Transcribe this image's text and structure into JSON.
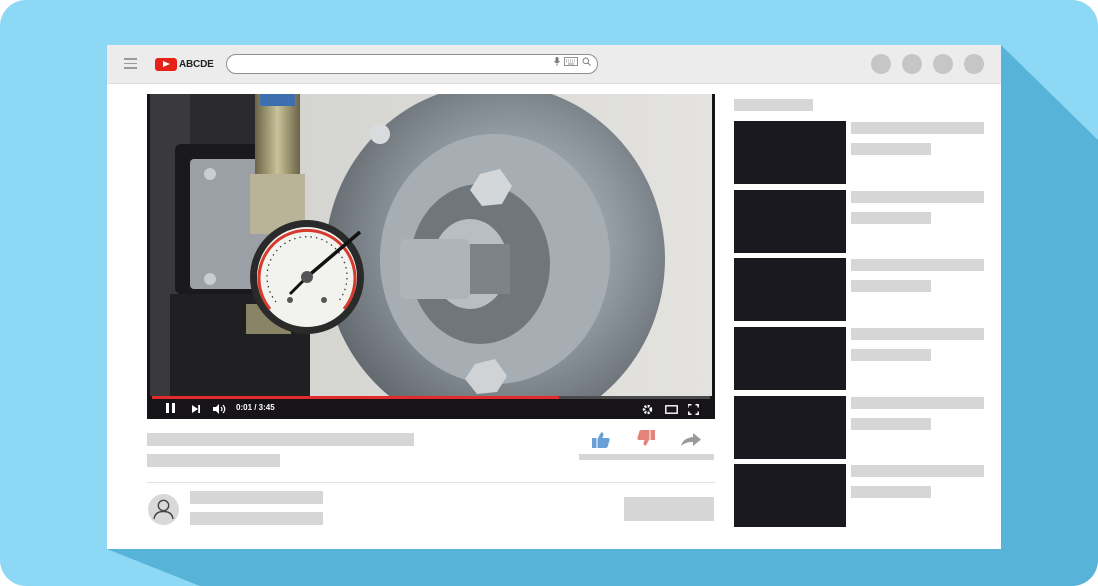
{
  "app": {
    "logo_text": "ABCDE"
  },
  "search": {
    "placeholder": ""
  },
  "player": {
    "time": "0:01 / 3:45",
    "progress_fraction": 0.73
  },
  "colors": {
    "frame": "#8dd8f5",
    "frame_shadow": "#57b3d8",
    "brand_red": "#e62117",
    "progress": "#e22c2c",
    "thumb": "#1b1920",
    "placeholder": "#d6d6d6"
  },
  "icons": {
    "menu": "hamburger-icon",
    "mic": "microphone-icon",
    "keyboard": "keyboard-icon",
    "search": "search-icon",
    "pause": "pause-icon",
    "next": "next-icon",
    "volume": "volume-icon",
    "settings": "gear-icon",
    "theater": "theater-mode-icon",
    "fullscreen": "fullscreen-icon",
    "like": "thumbs-up-icon",
    "dislike": "thumbs-down-icon",
    "share": "share-icon",
    "avatar": "user-icon"
  }
}
